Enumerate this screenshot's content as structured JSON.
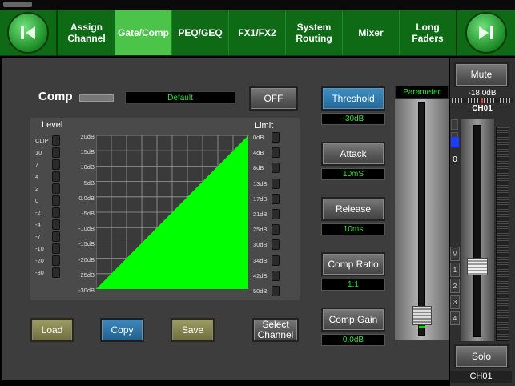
{
  "nav": {
    "tabs": [
      {
        "label": "Assign Channel",
        "active": false
      },
      {
        "label": "Gate/Comp",
        "active": true
      },
      {
        "label": "PEQ/GEQ",
        "active": false
      },
      {
        "label": "FX1/FX2",
        "active": false
      },
      {
        "label": "System Routing",
        "active": false
      },
      {
        "label": "Mixer",
        "active": false
      },
      {
        "label": "Long Faders",
        "active": false
      }
    ],
    "prev_icon": "skip-back-icon",
    "next_icon": "skip-forward-icon"
  },
  "comp": {
    "title": "Comp",
    "preset": "Default",
    "off_label": "OFF",
    "level_label": "Level",
    "limit_label": "Limit",
    "level_scale": [
      "CLIP",
      "10",
      "7",
      "4",
      "2",
      "0",
      "-2",
      "-4",
      "-7",
      "-10",
      "-20",
      "-30"
    ],
    "limit_scale": [
      "0dB",
      "4dB",
      "8dB",
      "13dB",
      "17dB",
      "21dB",
      "25dB",
      "30dB",
      "34dB",
      "42dB",
      "50dB"
    ],
    "graph_y_ticks": [
      "20dB",
      "15dB",
      "10dB",
      "5dB",
      "0.0dB",
      "-5dB",
      "-10dB",
      "-15dB",
      "-20dB",
      "-25dB",
      "-30dB"
    ]
  },
  "actions": {
    "load": "Load",
    "copy": "Copy",
    "save": "Save",
    "select_channel": "Select Channel"
  },
  "params": [
    {
      "label": "Threshold",
      "value": "-30dB",
      "selected": true
    },
    {
      "label": "Attack",
      "value": "10mS",
      "selected": false
    },
    {
      "label": "Release",
      "value": "10ms",
      "selected": false
    },
    {
      "label": "Comp Ratio",
      "value": "1:1",
      "selected": false
    },
    {
      "label": "Comp Gain",
      "value": "0.0dB",
      "selected": false
    }
  ],
  "parameter_fader": {
    "label": "Parameter"
  },
  "channel": {
    "mute": "Mute",
    "level": "-18.0dB",
    "name": "CH01",
    "pan_zero": "0",
    "groups": [
      "M",
      "1",
      "2",
      "3",
      "4"
    ],
    "solo": "Solo",
    "footer": "CH01"
  },
  "colors": {
    "accent_green": "#4cc44a",
    "curve_green": "#00ff00",
    "value_text": "#38e038"
  }
}
